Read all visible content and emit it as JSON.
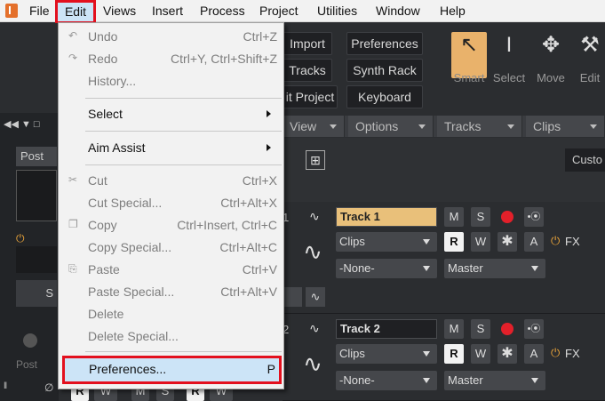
{
  "menubar": {
    "items": [
      "File",
      "Edit",
      "Views",
      "Insert",
      "Process",
      "Project",
      "Utilities",
      "Window",
      "Help"
    ]
  },
  "toolbar": {
    "buttons": [
      "Import",
      "Preferences",
      "Tracks",
      "Synth Rack",
      "it Project",
      "Keyboard"
    ],
    "tools": [
      "Smart",
      "Select",
      "Move",
      "Edit"
    ]
  },
  "left_panel": {
    "post_label": "Post",
    "s_label": "S",
    "post2_label": "Post",
    "s_row": [
      "R",
      "W",
      "M",
      "S",
      "R",
      "W"
    ]
  },
  "sections": [
    "View",
    "Options",
    "Tracks",
    "Clips"
  ],
  "custom_label": "Custo",
  "tracks": [
    {
      "number": "1",
      "name": "Track 1",
      "mute": "M",
      "solo": "S",
      "clips": "Clips",
      "read": "R",
      "write": "W",
      "input": "-None-",
      "output": "Master",
      "a": "A",
      "fx": "FX"
    },
    {
      "number": "2",
      "name": "Track 2",
      "mute": "M",
      "solo": "S",
      "clips": "Clips",
      "read": "R",
      "write": "W",
      "input": "-None-",
      "output": "Master",
      "a": "A",
      "fx": "FX"
    }
  ],
  "edit_menu": {
    "items": [
      {
        "label": "Undo",
        "shortcut": "Ctrl+Z",
        "enabled": false,
        "icon": "undo-icon"
      },
      {
        "label": "Redo",
        "shortcut": "Ctrl+Y, Ctrl+Shift+Z",
        "enabled": false,
        "icon": "redo-icon"
      },
      {
        "label": "History...",
        "shortcut": "",
        "enabled": false
      },
      {
        "label": "Select",
        "shortcut": "",
        "enabled": true,
        "submenu": true
      },
      {
        "label": "Aim Assist",
        "shortcut": "",
        "enabled": true,
        "submenu": true
      },
      {
        "label": "Cut",
        "shortcut": "Ctrl+X",
        "enabled": false,
        "icon": "scissors-icon"
      },
      {
        "label": "Cut Special...",
        "shortcut": "Ctrl+Alt+X",
        "enabled": false
      },
      {
        "label": "Copy",
        "shortcut": "Ctrl+Insert, Ctrl+C",
        "enabled": false,
        "icon": "copy-icon"
      },
      {
        "label": "Copy Special...",
        "shortcut": "Ctrl+Alt+C",
        "enabled": false
      },
      {
        "label": "Paste",
        "shortcut": "Ctrl+V",
        "enabled": false,
        "icon": "paste-icon"
      },
      {
        "label": "Paste Special...",
        "shortcut": "Ctrl+Alt+V",
        "enabled": false
      },
      {
        "label": "Delete",
        "shortcut": "",
        "enabled": false
      },
      {
        "label": "Delete Special...",
        "shortcut": "",
        "enabled": false
      },
      {
        "label": "Preferences...",
        "shortcut": "P",
        "enabled": true
      }
    ]
  },
  "colors": {
    "highlight": "#cce4f7",
    "annotation": "#e3101e",
    "track_name_bg": "#e9c07a",
    "record": "#e3202a",
    "fx": "#e8a33a"
  }
}
